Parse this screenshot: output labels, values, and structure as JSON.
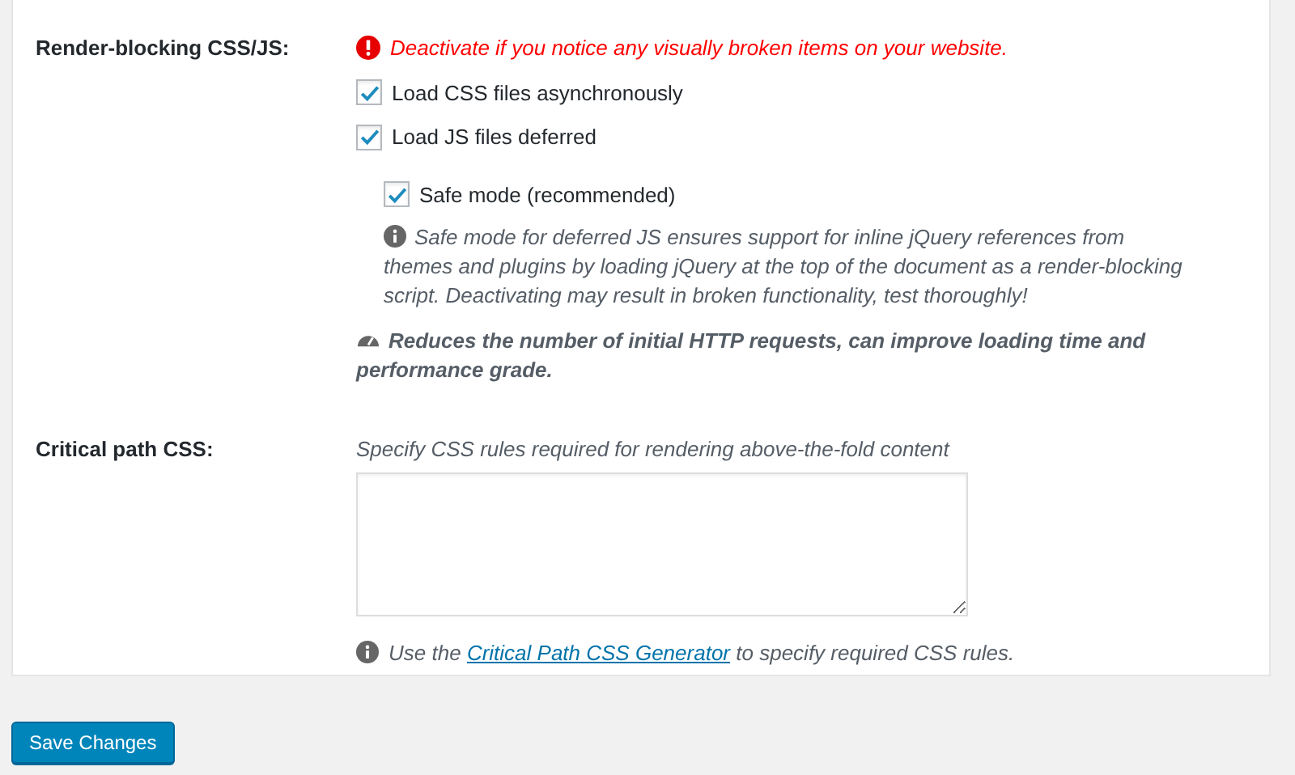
{
  "sections": [
    {
      "kind": "options",
      "label": "Render-blocking CSS/JS:",
      "warning": "Deactivate if you notice any visually broken items on your website.",
      "options": [
        {
          "label": "Load CSS files asynchronously",
          "checked": true
        },
        {
          "label": "Load JS files deferred",
          "checked": true
        }
      ],
      "sub_option": {
        "label": "Safe mode (recommended)",
        "checked": true
      },
      "sub_info": "Safe mode for deferred JS ensures support for inline jQuery references from themes and plugins by loading jQuery at the top of the document as a render-blocking script. Deactivating may result in broken functionality, test thoroughly!",
      "note": "Reduces the number of initial HTTP requests, can improve loading time and performance grade."
    },
    {
      "kind": "textarea",
      "label": "Critical path CSS:",
      "hint": "Specify CSS rules required for rendering above-the-fold content",
      "info_before": "Use the",
      "info_link": "Critical Path CSS Generator",
      "info_after": "to specify required CSS rules."
    }
  ],
  "save_button": "Save Changes"
}
